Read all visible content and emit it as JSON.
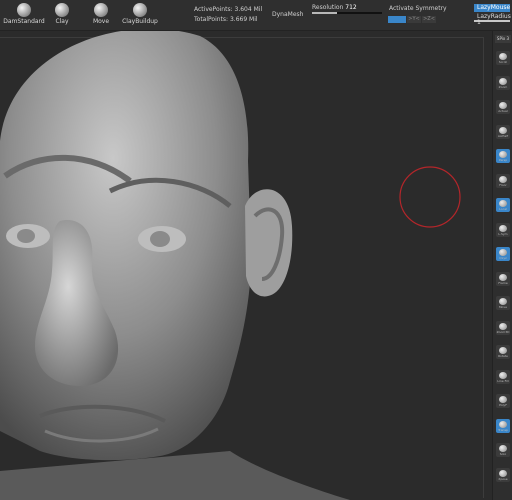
{
  "brushes": [
    {
      "label": "DamStandard"
    },
    {
      "label": "Clay"
    },
    {
      "label": "Move"
    },
    {
      "label": "ClayBuildup"
    }
  ],
  "stats": {
    "active_points": "ActivePoints: 3.604 Mil",
    "total_points": "TotalPoints: 3.669 Mil"
  },
  "dynamesh": {
    "label": "DynaMesh"
  },
  "resolution": {
    "label": "Resolution",
    "value": "712",
    "fill_fraction": 0.35
  },
  "symmetry": {
    "label": "Activate Symmetry",
    "axes": [
      "",
      ">Y<",
      ">Z<"
    ],
    "x_active": true
  },
  "lazy": {
    "mouse": "LazyMouse",
    "radius": "LazyRadius 1"
  },
  "sidebar": {
    "spix": "SPix 3",
    "tools": [
      {
        "icon": "scroll-icon",
        "label": "Scroll",
        "active": false
      },
      {
        "icon": "zoom-icon",
        "label": "Zoom",
        "active": false
      },
      {
        "icon": "actual-icon",
        "label": "Actual",
        "active": false
      },
      {
        "icon": "aahalf-icon",
        "label": "AAHalf",
        "active": false
      },
      {
        "icon": "persp-icon",
        "label": "Persp",
        "active": true
      },
      {
        "icon": "floor-icon",
        "label": "Floor",
        "active": false
      },
      {
        "icon": "local-icon",
        "label": "Local",
        "active": true
      },
      {
        "icon": "lsym-icon",
        "label": "L.Sym",
        "active": false
      },
      {
        "icon": "xyz-icon",
        "label": "Qxyz",
        "active": true
      },
      {
        "icon": "frame-icon",
        "label": "Frame",
        "active": false
      },
      {
        "icon": "move-icon",
        "label": "Move",
        "active": false
      },
      {
        "icon": "zoom3d-icon",
        "label": "Zoom3D",
        "active": false
      },
      {
        "icon": "rotate-icon",
        "label": "Rotate",
        "active": false
      },
      {
        "icon": "linefill-icon",
        "label": "Line Fill",
        "active": false
      },
      {
        "icon": "polyf-icon",
        "label": "PolyF",
        "active": false
      },
      {
        "icon": "transp-icon",
        "label": "Transp",
        "active": true
      },
      {
        "icon": "solo-icon",
        "label": "Solo",
        "active": false
      },
      {
        "icon": "xpose-icon",
        "label": "Xpose",
        "active": false
      }
    ]
  },
  "colors": {
    "accent": "#3a86c9",
    "brush_cursor": "#b3262a",
    "background": "#2b2b2b"
  }
}
